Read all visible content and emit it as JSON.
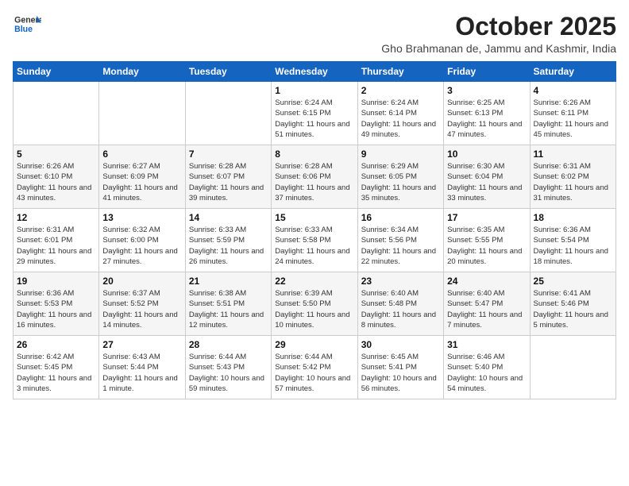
{
  "header": {
    "logo_line1": "General",
    "logo_line2": "Blue",
    "month_title": "October 2025",
    "location": "Gho Brahmanan de, Jammu and Kashmir, India"
  },
  "weekdays": [
    "Sunday",
    "Monday",
    "Tuesday",
    "Wednesday",
    "Thursday",
    "Friday",
    "Saturday"
  ],
  "weeks": [
    [
      {
        "day": "",
        "sunrise": "",
        "sunset": "",
        "daylight": ""
      },
      {
        "day": "",
        "sunrise": "",
        "sunset": "",
        "daylight": ""
      },
      {
        "day": "",
        "sunrise": "",
        "sunset": "",
        "daylight": ""
      },
      {
        "day": "1",
        "sunrise": "Sunrise: 6:24 AM",
        "sunset": "Sunset: 6:15 PM",
        "daylight": "Daylight: 11 hours and 51 minutes."
      },
      {
        "day": "2",
        "sunrise": "Sunrise: 6:24 AM",
        "sunset": "Sunset: 6:14 PM",
        "daylight": "Daylight: 11 hours and 49 minutes."
      },
      {
        "day": "3",
        "sunrise": "Sunrise: 6:25 AM",
        "sunset": "Sunset: 6:13 PM",
        "daylight": "Daylight: 11 hours and 47 minutes."
      },
      {
        "day": "4",
        "sunrise": "Sunrise: 6:26 AM",
        "sunset": "Sunset: 6:11 PM",
        "daylight": "Daylight: 11 hours and 45 minutes."
      }
    ],
    [
      {
        "day": "5",
        "sunrise": "Sunrise: 6:26 AM",
        "sunset": "Sunset: 6:10 PM",
        "daylight": "Daylight: 11 hours and 43 minutes."
      },
      {
        "day": "6",
        "sunrise": "Sunrise: 6:27 AM",
        "sunset": "Sunset: 6:09 PM",
        "daylight": "Daylight: 11 hours and 41 minutes."
      },
      {
        "day": "7",
        "sunrise": "Sunrise: 6:28 AM",
        "sunset": "Sunset: 6:07 PM",
        "daylight": "Daylight: 11 hours and 39 minutes."
      },
      {
        "day": "8",
        "sunrise": "Sunrise: 6:28 AM",
        "sunset": "Sunset: 6:06 PM",
        "daylight": "Daylight: 11 hours and 37 minutes."
      },
      {
        "day": "9",
        "sunrise": "Sunrise: 6:29 AM",
        "sunset": "Sunset: 6:05 PM",
        "daylight": "Daylight: 11 hours and 35 minutes."
      },
      {
        "day": "10",
        "sunrise": "Sunrise: 6:30 AM",
        "sunset": "Sunset: 6:04 PM",
        "daylight": "Daylight: 11 hours and 33 minutes."
      },
      {
        "day": "11",
        "sunrise": "Sunrise: 6:31 AM",
        "sunset": "Sunset: 6:02 PM",
        "daylight": "Daylight: 11 hours and 31 minutes."
      }
    ],
    [
      {
        "day": "12",
        "sunrise": "Sunrise: 6:31 AM",
        "sunset": "Sunset: 6:01 PM",
        "daylight": "Daylight: 11 hours and 29 minutes."
      },
      {
        "day": "13",
        "sunrise": "Sunrise: 6:32 AM",
        "sunset": "Sunset: 6:00 PM",
        "daylight": "Daylight: 11 hours and 27 minutes."
      },
      {
        "day": "14",
        "sunrise": "Sunrise: 6:33 AM",
        "sunset": "Sunset: 5:59 PM",
        "daylight": "Daylight: 11 hours and 26 minutes."
      },
      {
        "day": "15",
        "sunrise": "Sunrise: 6:33 AM",
        "sunset": "Sunset: 5:58 PM",
        "daylight": "Daylight: 11 hours and 24 minutes."
      },
      {
        "day": "16",
        "sunrise": "Sunrise: 6:34 AM",
        "sunset": "Sunset: 5:56 PM",
        "daylight": "Daylight: 11 hours and 22 minutes."
      },
      {
        "day": "17",
        "sunrise": "Sunrise: 6:35 AM",
        "sunset": "Sunset: 5:55 PM",
        "daylight": "Daylight: 11 hours and 20 minutes."
      },
      {
        "day": "18",
        "sunrise": "Sunrise: 6:36 AM",
        "sunset": "Sunset: 5:54 PM",
        "daylight": "Daylight: 11 hours and 18 minutes."
      }
    ],
    [
      {
        "day": "19",
        "sunrise": "Sunrise: 6:36 AM",
        "sunset": "Sunset: 5:53 PM",
        "daylight": "Daylight: 11 hours and 16 minutes."
      },
      {
        "day": "20",
        "sunrise": "Sunrise: 6:37 AM",
        "sunset": "Sunset: 5:52 PM",
        "daylight": "Daylight: 11 hours and 14 minutes."
      },
      {
        "day": "21",
        "sunrise": "Sunrise: 6:38 AM",
        "sunset": "Sunset: 5:51 PM",
        "daylight": "Daylight: 11 hours and 12 minutes."
      },
      {
        "day": "22",
        "sunrise": "Sunrise: 6:39 AM",
        "sunset": "Sunset: 5:50 PM",
        "daylight": "Daylight: 11 hours and 10 minutes."
      },
      {
        "day": "23",
        "sunrise": "Sunrise: 6:40 AM",
        "sunset": "Sunset: 5:48 PM",
        "daylight": "Daylight: 11 hours and 8 minutes."
      },
      {
        "day": "24",
        "sunrise": "Sunrise: 6:40 AM",
        "sunset": "Sunset: 5:47 PM",
        "daylight": "Daylight: 11 hours and 7 minutes."
      },
      {
        "day": "25",
        "sunrise": "Sunrise: 6:41 AM",
        "sunset": "Sunset: 5:46 PM",
        "daylight": "Daylight: 11 hours and 5 minutes."
      }
    ],
    [
      {
        "day": "26",
        "sunrise": "Sunrise: 6:42 AM",
        "sunset": "Sunset: 5:45 PM",
        "daylight": "Daylight: 11 hours and 3 minutes."
      },
      {
        "day": "27",
        "sunrise": "Sunrise: 6:43 AM",
        "sunset": "Sunset: 5:44 PM",
        "daylight": "Daylight: 11 hours and 1 minute."
      },
      {
        "day": "28",
        "sunrise": "Sunrise: 6:44 AM",
        "sunset": "Sunset: 5:43 PM",
        "daylight": "Daylight: 10 hours and 59 minutes."
      },
      {
        "day": "29",
        "sunrise": "Sunrise: 6:44 AM",
        "sunset": "Sunset: 5:42 PM",
        "daylight": "Daylight: 10 hours and 57 minutes."
      },
      {
        "day": "30",
        "sunrise": "Sunrise: 6:45 AM",
        "sunset": "Sunset: 5:41 PM",
        "daylight": "Daylight: 10 hours and 56 minutes."
      },
      {
        "day": "31",
        "sunrise": "Sunrise: 6:46 AM",
        "sunset": "Sunset: 5:40 PM",
        "daylight": "Daylight: 10 hours and 54 minutes."
      },
      {
        "day": "",
        "sunrise": "",
        "sunset": "",
        "daylight": ""
      }
    ]
  ]
}
